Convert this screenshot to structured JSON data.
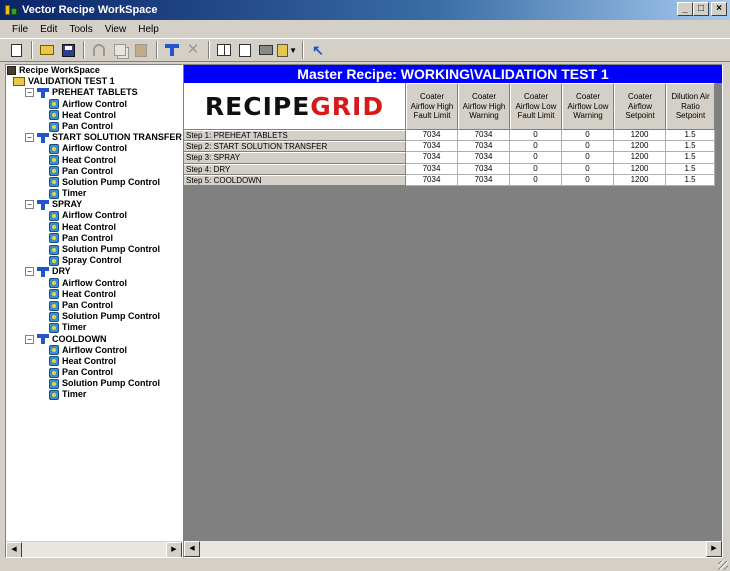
{
  "window": {
    "title": "Vector Recipe WorkSpace",
    "controls": {
      "minimize": "_",
      "maximize": "□",
      "close": "×"
    }
  },
  "menu": [
    "File",
    "Edit",
    "Tools",
    "View",
    "Help"
  ],
  "toolbar": {
    "icons": [
      "new-icon",
      "open-icon",
      "save-icon",
      "cut-icon",
      "copy-icon",
      "paste-icon",
      "add-step-icon",
      "delete-icon",
      "columns-icon",
      "print-preview-icon",
      "print-icon",
      "report-icon",
      "help-pointer-icon"
    ]
  },
  "tree": {
    "root": "Recipe WorkSpace",
    "recipe": "VALIDATION TEST 1",
    "steps": [
      {
        "label": "PREHEAT TABLETS",
        "children": [
          "Airflow Control",
          "Heat Control",
          "Pan Control"
        ]
      },
      {
        "label": "START SOLUTION TRANSFER",
        "children": [
          "Airflow Control",
          "Heat Control",
          "Pan Control",
          "Solution Pump Control",
          "Timer"
        ]
      },
      {
        "label": "SPRAY",
        "children": [
          "Airflow Control",
          "Heat Control",
          "Pan Control",
          "Solution Pump Control",
          "Spray Control"
        ]
      },
      {
        "label": "DRY",
        "children": [
          "Airflow Control",
          "Heat Control",
          "Pan Control",
          "Solution Pump Control",
          "Timer"
        ]
      },
      {
        "label": "COOLDOWN",
        "children": [
          "Airflow Control",
          "Heat Control",
          "Pan Control",
          "Solution Pump Control",
          "Timer"
        ]
      }
    ]
  },
  "grid": {
    "title": "Master Recipe: WORKING\\VALIDATION TEST 1",
    "logo": {
      "word1": "RECIPE",
      "word2": "GRID"
    },
    "columns": [
      "Coater Airflow High Fault Limit",
      "Coater Airflow High Warning",
      "Coater Airflow Low Fault Limit",
      "Coater Airflow Low Warning",
      "Coater Airflow Setpoint",
      "Dilution Air Ratio Setpoint"
    ],
    "rows": [
      {
        "label": "Step 1: PREHEAT TABLETS",
        "values": [
          "7034",
          "7034",
          "0",
          "0",
          "1200",
          "1.5"
        ]
      },
      {
        "label": "Step 2: START SOLUTION TRANSFER",
        "values": [
          "7034",
          "7034",
          "0",
          "0",
          "1200",
          "1.5"
        ]
      },
      {
        "label": "Step 3: SPRAY",
        "values": [
          "7034",
          "7034",
          "0",
          "0",
          "1200",
          "1.5"
        ]
      },
      {
        "label": "Step 4: DRY",
        "values": [
          "7034",
          "7034",
          "0",
          "0",
          "1200",
          "1.5"
        ]
      },
      {
        "label": "Step 5: COOLDOWN",
        "values": [
          "7034",
          "7034",
          "0",
          "0",
          "1200",
          "1.5"
        ]
      }
    ]
  },
  "colors": {
    "title_bar": "#0a246a",
    "grid_title": "#0000ff",
    "logo_red": "#d61a1a"
  }
}
